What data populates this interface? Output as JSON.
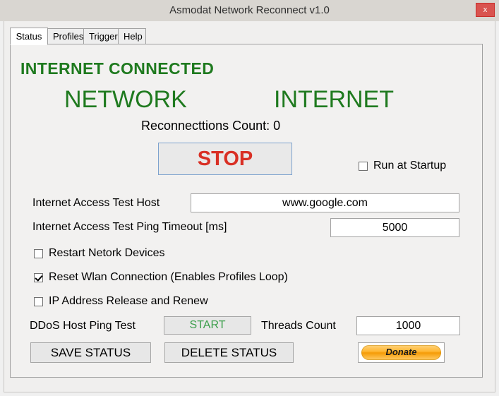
{
  "window": {
    "title": "Asmodat Network Reconnect v1.0",
    "close_label": "x"
  },
  "tabs": [
    {
      "label": "Status",
      "selected": true
    },
    {
      "label": "Profiles",
      "selected": false
    },
    {
      "label": "Trigger",
      "selected": false
    },
    {
      "label": "Help",
      "selected": false
    }
  ],
  "status": {
    "main_message": "INTERNET CONNECTED",
    "network_label": "NETWORK",
    "internet_label": "INTERNET",
    "reconnections_text": "Reconnecttions Count:  0",
    "reconnections_count": "0",
    "green_color": "#1f7a1f"
  },
  "controls": {
    "stop_button": "STOP",
    "stop_color": "#d93025",
    "run_at_startup": {
      "label": "Run at Startup",
      "checked": false
    }
  },
  "fields": {
    "host": {
      "label": "Internet Access Test Host",
      "value": "www.google.com",
      "placeholder": "www.google.com"
    },
    "ping_timeout": {
      "label": "Internet Access Test Ping Timeout [ms]",
      "value": "5000",
      "placeholder": "5000"
    },
    "threads_count": {
      "label": "Threads Count",
      "value": "1000",
      "placeholder": "1000"
    }
  },
  "options": [
    {
      "label": "Restart Netork Devices",
      "checked": false
    },
    {
      "label": "Reset Wlan Connection (Enables Profiles Loop)",
      "checked": true
    },
    {
      "label": "IP Address Release and Renew",
      "checked": false
    }
  ],
  "ddos": {
    "label": "DDoS Host Ping Test",
    "start_button": "START",
    "start_color": "#3a9e4a"
  },
  "actions": {
    "save_status": "SAVE STATUS",
    "delete_status": "DELETE STATUS",
    "donate": "Donate",
    "donate_color": "#f59b06"
  }
}
